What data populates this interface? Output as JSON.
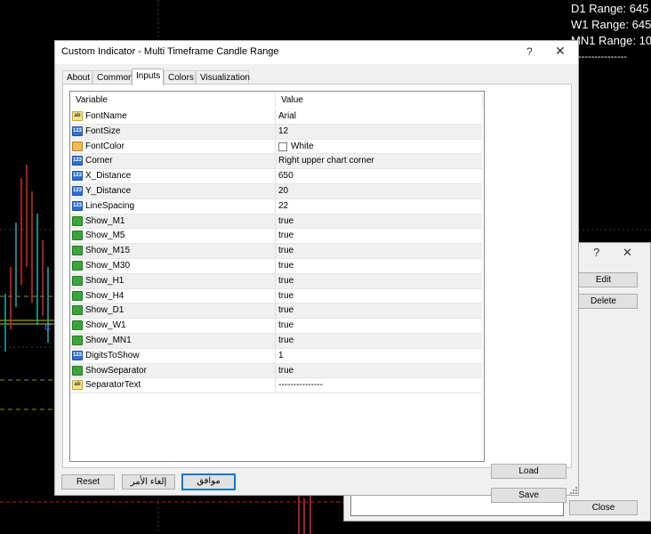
{
  "chart": {
    "info_lines": [
      "D1  Range: 645",
      "W1  Range: 645",
      "MN1  Range: 10"
    ],
    "separator": "---------------"
  },
  "background_dialog": {
    "help_icon": "?",
    "close_icon": "✕",
    "edit_label": "Edit",
    "delete_label": "Delete",
    "close_label": "Close"
  },
  "dialog": {
    "title": "Custom Indicator - Multi Timeframe Candle Range",
    "help_icon": "?",
    "close_icon": "✕",
    "tabs": [
      "About",
      "Common",
      "Inputs",
      "Colors",
      "Visualization"
    ],
    "active_tab": "Inputs",
    "grid": {
      "col_variable": "Variable",
      "col_value": "Value",
      "rows": [
        {
          "name": "FontName",
          "value": "Arial",
          "type": "string",
          "icon": "ab"
        },
        {
          "name": "FontSize",
          "value": "12",
          "type": "int",
          "icon": "123"
        },
        {
          "name": "FontColor",
          "value": "White",
          "type": "color",
          "icon": "color-icon"
        },
        {
          "name": "Corner",
          "value": "Right upper chart corner",
          "type": "enum",
          "icon": "123"
        },
        {
          "name": "X_Distance",
          "value": "650",
          "type": "int",
          "icon": "123"
        },
        {
          "name": "Y_Distance",
          "value": "20",
          "type": "int",
          "icon": "123"
        },
        {
          "name": "LineSpacing",
          "value": "22",
          "type": "int",
          "icon": "123"
        },
        {
          "name": "Show_M1",
          "value": "true",
          "type": "bool",
          "icon": "bool-icon"
        },
        {
          "name": "Show_M5",
          "value": "true",
          "type": "bool",
          "icon": "bool-icon"
        },
        {
          "name": "Show_M15",
          "value": "true",
          "type": "bool",
          "icon": "bool-icon"
        },
        {
          "name": "Show_M30",
          "value": "true",
          "type": "bool",
          "icon": "bool-icon"
        },
        {
          "name": "Show_H1",
          "value": "true",
          "type": "bool",
          "icon": "bool-icon"
        },
        {
          "name": "Show_H4",
          "value": "true",
          "type": "bool",
          "icon": "bool-icon"
        },
        {
          "name": "Show_D1",
          "value": "true",
          "type": "bool",
          "icon": "bool-icon"
        },
        {
          "name": "Show_W1",
          "value": "true",
          "type": "bool",
          "icon": "bool-icon"
        },
        {
          "name": "Show_MN1",
          "value": "true",
          "type": "bool",
          "icon": "bool-icon"
        },
        {
          "name": "DigitsToShow",
          "value": "1",
          "type": "int",
          "icon": "123"
        },
        {
          "name": "ShowSeparator",
          "value": "true",
          "type": "bool",
          "icon": "bool-icon"
        },
        {
          "name": "SeparatorText",
          "value": "---------------",
          "type": "string",
          "icon": "ab"
        }
      ]
    },
    "load_label": "Load",
    "save_label": "Save",
    "reset_label": "Reset",
    "cancel_label": "إلغاء الأمر",
    "ok_label": "موافق"
  }
}
